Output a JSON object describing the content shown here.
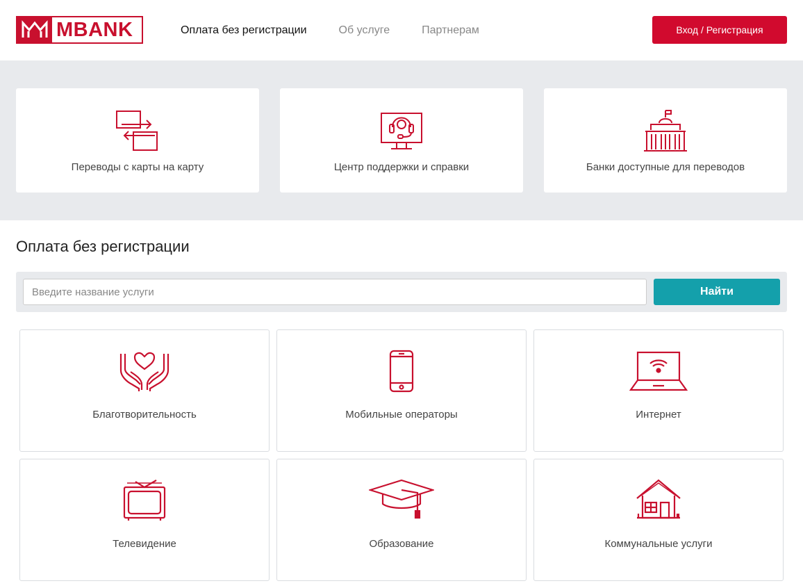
{
  "header": {
    "logo_text": "MBANK",
    "nav": [
      {
        "label": "Оплата без регистрации",
        "active": true
      },
      {
        "label": "Об услуге",
        "active": false
      },
      {
        "label": "Партнерам",
        "active": false
      }
    ],
    "login_label": "Вход / Регистрация"
  },
  "quick_links": [
    {
      "label": "Переводы с карты на карту",
      "icon": "transfer-icon"
    },
    {
      "label": "Центр поддержки и справки",
      "icon": "support-headset-icon"
    },
    {
      "label": "Банки доступные для переводов",
      "icon": "bank-building-icon"
    }
  ],
  "main": {
    "title": "Оплата без регистрации",
    "search": {
      "placeholder": "Введите название услуги",
      "value": "",
      "button_label": "Найти"
    },
    "services": [
      {
        "label": "Благотворительность",
        "icon": "charity-hands-heart-icon"
      },
      {
        "label": "Мобильные операторы",
        "icon": "mobile-phone-icon"
      },
      {
        "label": "Интернет",
        "icon": "laptop-wifi-icon"
      },
      {
        "label": "Телевидение",
        "icon": "tv-icon"
      },
      {
        "label": "Образование",
        "icon": "graduation-cap-icon"
      },
      {
        "label": "Коммунальные услуги",
        "icon": "house-icon"
      }
    ]
  },
  "colors": {
    "brand_red": "#d10a2e",
    "accent_teal": "#14a0ab",
    "band_gray": "#e8eaed"
  }
}
